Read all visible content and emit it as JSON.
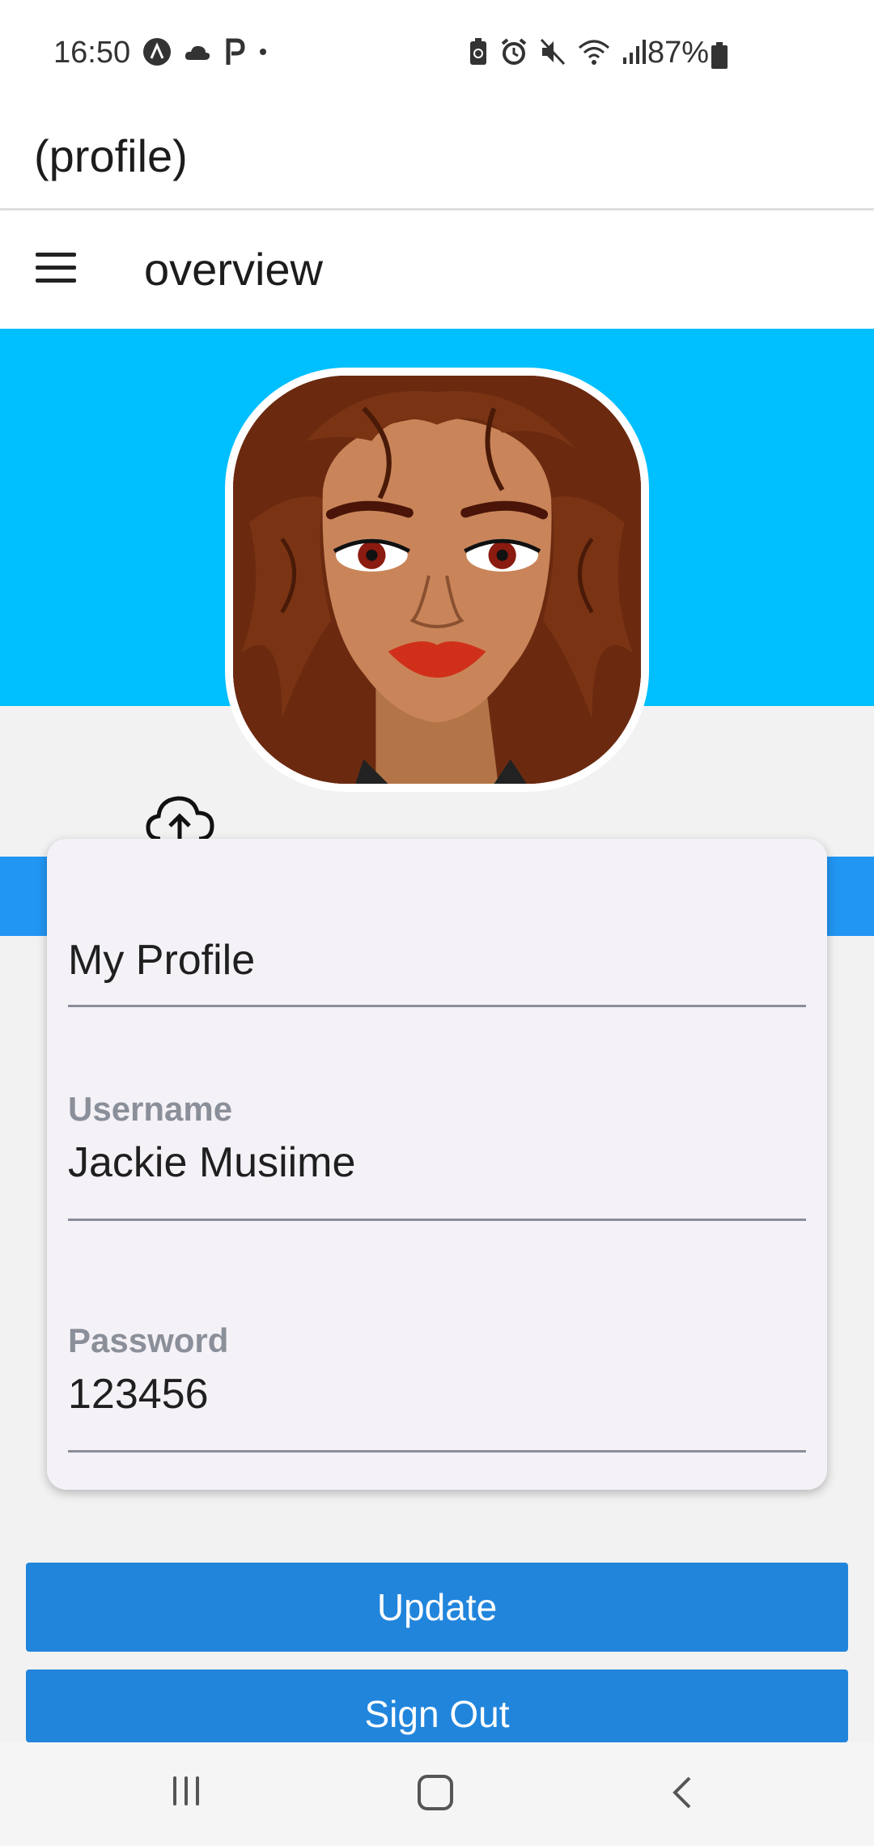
{
  "status_bar": {
    "time": "16:50",
    "battery_percent": "87%",
    "left_icons": [
      "notification-a-icon",
      "weather-cloud-icon",
      "parking-p-icon",
      "dot-icon"
    ],
    "right_icons": [
      "battery-saver-icon",
      "alarm-icon",
      "mute-icon",
      "wifi-icon",
      "signal-icon",
      "battery-icon"
    ]
  },
  "header": {
    "title": "(profile)"
  },
  "drawer_bar": {
    "title": "overview",
    "menu_icon": "hamburger-menu-icon"
  },
  "colors": {
    "banner": "#00bfff",
    "accent": "#2185dc",
    "strip": "#2196f3",
    "card": "#f4f1f7"
  },
  "profile_card": {
    "heading": "My Profile",
    "username_label": "Username",
    "username_value": "Jackie Musiime",
    "password_label": "Password",
    "password_value": "123456"
  },
  "upload_icon": "cloud-upload-icon",
  "buttons": {
    "update": "Update",
    "sign_out": "Sign Out"
  },
  "nav_bar": {
    "items": [
      "recent-apps-icon",
      "home-icon",
      "back-icon"
    ]
  }
}
